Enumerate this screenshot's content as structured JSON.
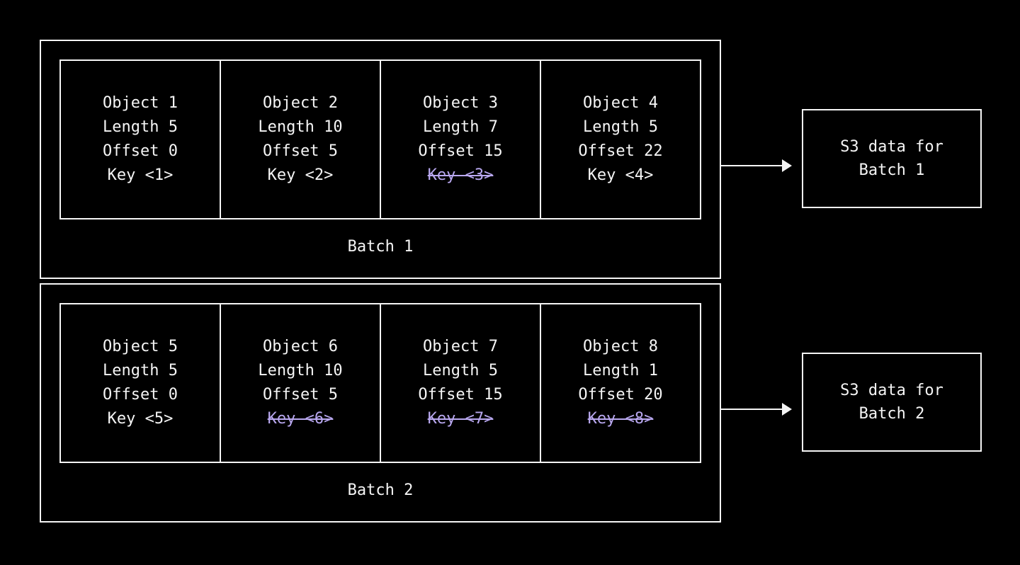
{
  "batches": [
    {
      "label": "Batch 1",
      "objects": [
        {
          "id": "Object 1",
          "length": "Length 5",
          "offset": "Offset 0",
          "key": "Key <1>",
          "key_struck": false
        },
        {
          "id": "Object 2",
          "length": "Length 10",
          "offset": "Offset 5",
          "key": "Key <2>",
          "key_struck": false
        },
        {
          "id": "Object 3",
          "length": "Length 7",
          "offset": "Offset 15",
          "key": "Key <3>",
          "key_struck": true
        },
        {
          "id": "Object 4",
          "length": "Length 5",
          "offset": "Offset 22",
          "key": "Key <4>",
          "key_struck": false
        }
      ],
      "s3": {
        "line1": "S3 data for",
        "line2": "Batch 1"
      }
    },
    {
      "label": "Batch 2",
      "objects": [
        {
          "id": "Object 5",
          "length": "Length 5",
          "offset": "Offset 0",
          "key": "Key <5>",
          "key_struck": false
        },
        {
          "id": "Object 6",
          "length": "Length 10",
          "offset": "Offset 5",
          "key": "Key <6>",
          "key_struck": true
        },
        {
          "id": "Object 7",
          "length": "Length 5",
          "offset": "Offset 15",
          "key": "Key <7>",
          "key_struck": true
        },
        {
          "id": "Object 8",
          "length": "Length 1",
          "offset": "Offset 20",
          "key": "Key <8>",
          "key_struck": true
        }
      ],
      "s3": {
        "line1": "S3 data for",
        "line2": "Batch 2"
      }
    }
  ]
}
